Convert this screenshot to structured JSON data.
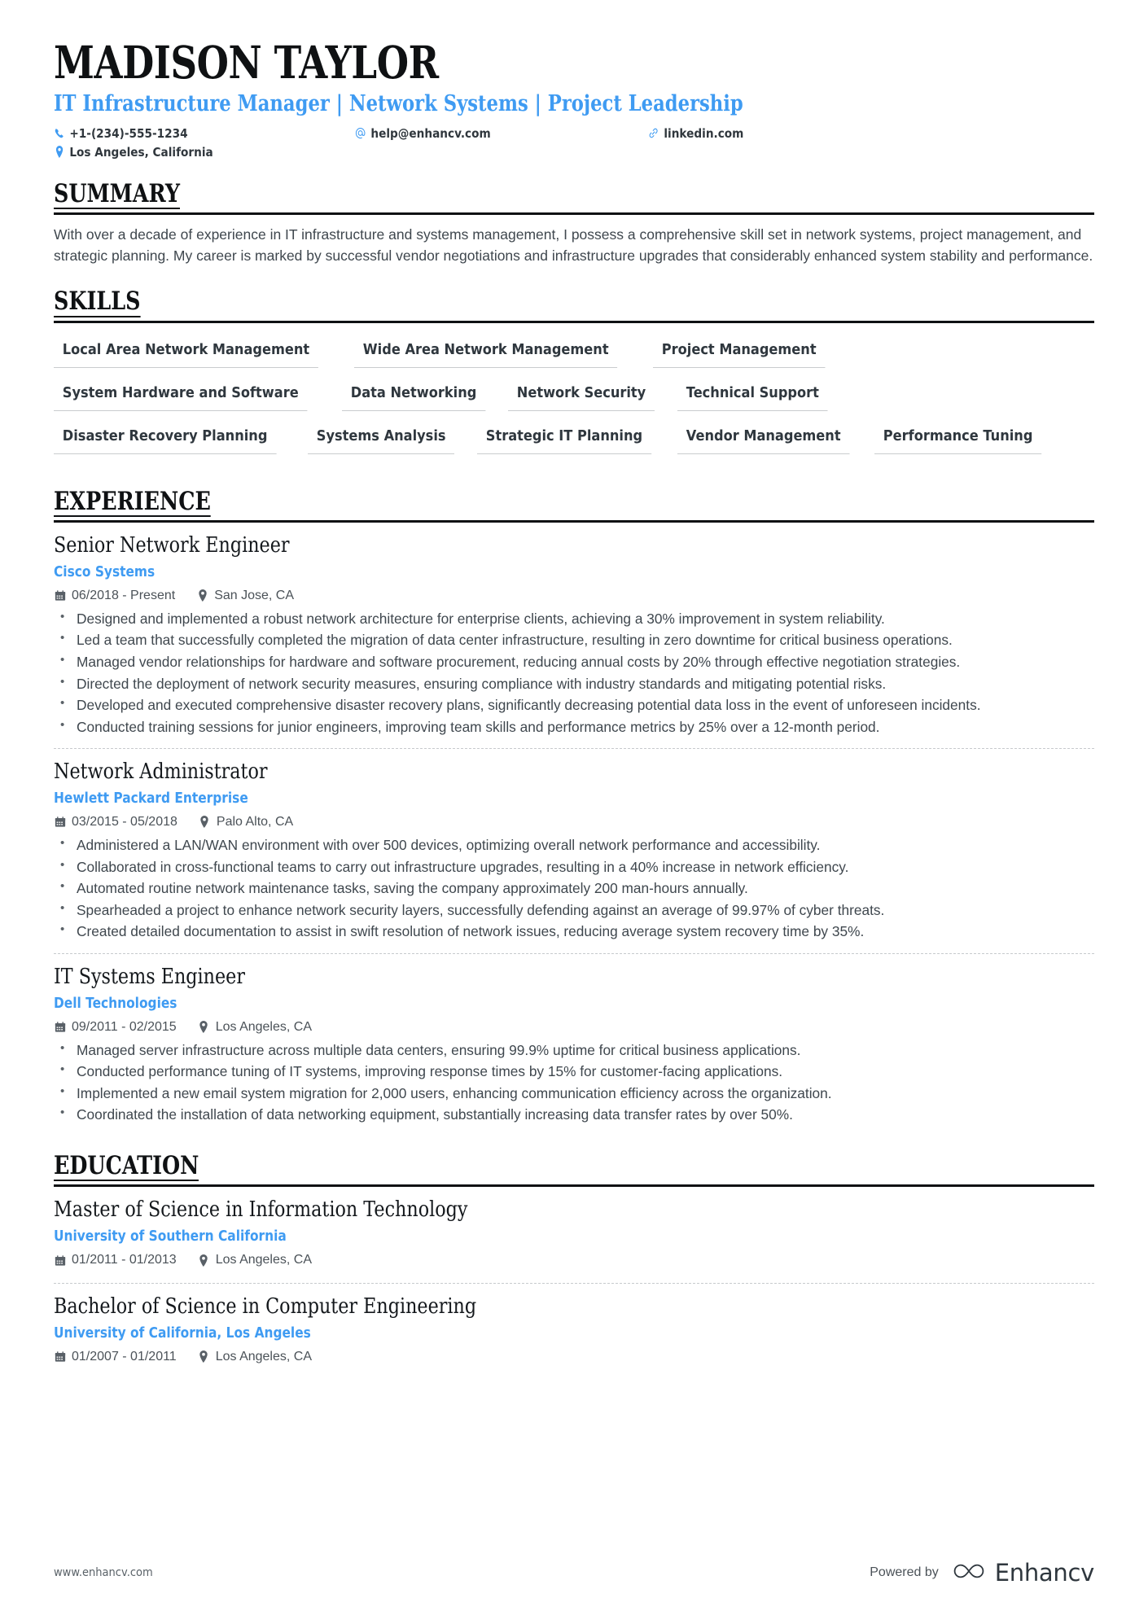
{
  "header": {
    "name": "MADISON TAYLOR",
    "headline": "IT Infrastructure Manager | Network Systems | Project Leadership",
    "phone": "+1-(234)-555-1234",
    "email": "help@enhancv.com",
    "linkedin": "linkedin.com",
    "location": "Los Angeles, California",
    "accent_color": "#3f9bf2"
  },
  "sections": {
    "summary_title": "SUMMARY",
    "skills_title": "SKILLS",
    "experience_title": "EXPERIENCE",
    "education_title": "EDUCATION"
  },
  "summary": {
    "text": "With over a decade of experience in IT infrastructure and systems management, I possess a comprehensive skill set in network systems, project management, and strategic planning. My career is marked by successful vendor negotiations and infrastructure upgrades that considerably enhanced system stability and performance."
  },
  "skills": [
    "Local Area Network Management",
    "Wide Area Network Management",
    "Project Management",
    "System Hardware and Software",
    "Data Networking",
    "Network Security",
    "Technical Support",
    "Disaster Recovery Planning",
    "Systems Analysis",
    "Strategic IT Planning",
    "Vendor Management",
    "Performance Tuning"
  ],
  "experience": [
    {
      "title": "Senior Network Engineer",
      "company": "Cisco Systems",
      "dates": "06/2018 - Present",
      "location": "San Jose, CA",
      "bullets": [
        "Designed and implemented a robust network architecture for enterprise clients, achieving a 30% improvement in system reliability.",
        "Led a team that successfully completed the migration of data center infrastructure, resulting in zero downtime for critical business operations.",
        "Managed vendor relationships for hardware and software procurement, reducing annual costs by 20% through effective negotiation strategies.",
        "Directed the deployment of network security measures, ensuring compliance with industry standards and mitigating potential risks.",
        "Developed and executed comprehensive disaster recovery plans, significantly decreasing potential data loss in the event of unforeseen incidents.",
        "Conducted training sessions for junior engineers, improving team skills and performance metrics by 25% over a 12-month period."
      ]
    },
    {
      "title": "Network Administrator",
      "company": "Hewlett Packard Enterprise",
      "dates": "03/2015 - 05/2018",
      "location": "Palo Alto, CA",
      "bullets": [
        "Administered a LAN/WAN environment with over 500 devices, optimizing overall network performance and accessibility.",
        "Collaborated in cross-functional teams to carry out infrastructure upgrades, resulting in a 40% increase in network efficiency.",
        "Automated routine network maintenance tasks, saving the company approximately 200 man-hours annually.",
        "Spearheaded a project to enhance network security layers, successfully defending against an average of 99.97% of cyber threats.",
        "Created detailed documentation to assist in swift resolution of network issues, reducing average system recovery time by 35%."
      ]
    },
    {
      "title": "IT Systems Engineer",
      "company": "Dell Technologies",
      "dates": "09/2011 - 02/2015",
      "location": "Los Angeles, CA",
      "bullets": [
        "Managed server infrastructure across multiple data centers, ensuring 99.9% uptime for critical business applications.",
        "Conducted performance tuning of IT systems, improving response times by 15% for customer-facing applications.",
        "Implemented a new email system migration for 2,000 users, enhancing communication efficiency across the organization.",
        "Coordinated the installation of data networking equipment, substantially increasing data transfer rates by over 50%."
      ]
    }
  ],
  "education": [
    {
      "title": "Master of Science in Information Technology",
      "school": "University of Southern California",
      "dates": "01/2011 - 01/2013",
      "location": "Los Angeles, CA"
    },
    {
      "title": "Bachelor of Science in Computer Engineering",
      "school": "University of California, Los Angeles",
      "dates": "01/2007 - 01/2011",
      "location": "Los Angeles, CA"
    }
  ],
  "footer": {
    "url": "www.enhancv.com",
    "powered_by": "Powered by",
    "brand": "Enhancv"
  }
}
